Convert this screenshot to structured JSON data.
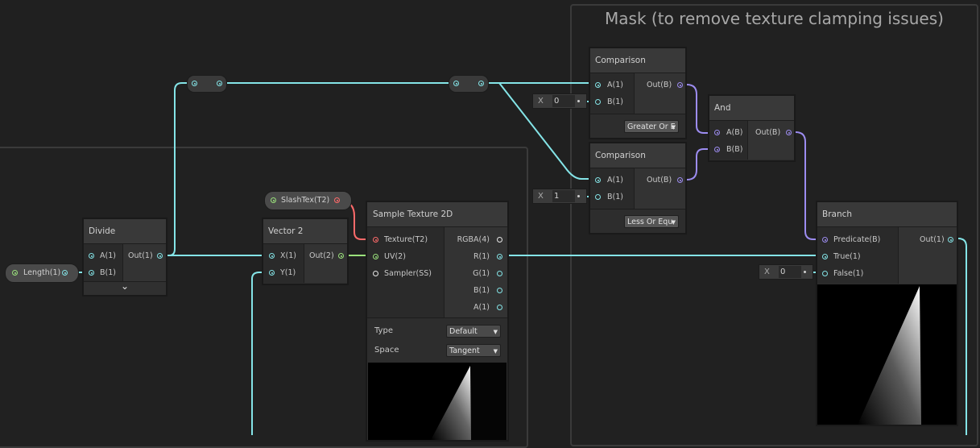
{
  "group": {
    "title": "Mask (to remove texture clamping issues)"
  },
  "properties": {
    "length": "Length(1)",
    "slashtex": "SlashTex(T2)"
  },
  "nodes": {
    "divide": {
      "title": "Divide",
      "in_a": "A(1)",
      "in_b": "B(1)",
      "out": "Out(1)",
      "collapse": "⌄"
    },
    "vector2": {
      "title": "Vector 2",
      "in_x": "X(1)",
      "in_y": "Y(1)",
      "out": "Out(2)"
    },
    "sample": {
      "title": "Sample Texture 2D",
      "in_texture": "Texture(T2)",
      "in_uv": "UV(2)",
      "in_sampler": "Sampler(SS)",
      "out_rgba": "RGBA(4)",
      "out_r": "R(1)",
      "out_g": "G(1)",
      "out_b": "B(1)",
      "out_a": "A(1)",
      "type_label": "Type",
      "type_value": "Default",
      "space_label": "Space",
      "space_value": "Tangent"
    },
    "comparison1": {
      "title": "Comparison",
      "in_a": "A(1)",
      "in_b": "B(1)",
      "out": "Out(B)",
      "mode": "Greater Or E"
    },
    "comparison2": {
      "title": "Comparison",
      "in_a": "A(1)",
      "in_b": "B(1)",
      "out": "Out(B)",
      "mode": "Less Or Equ"
    },
    "and": {
      "title": "And",
      "in_a": "A(B)",
      "in_b": "B(B)",
      "out": "Out(B)"
    },
    "branch": {
      "title": "Branch",
      "in_pred": "Predicate(B)",
      "in_true": "True(1)",
      "in_false": "False(1)",
      "out": "Out(1)"
    }
  },
  "fields": {
    "cmp1_b": {
      "label": "X",
      "value": "0"
    },
    "cmp2_b": {
      "label": "X",
      "value": "1"
    },
    "branch_false": {
      "label": "X",
      "value": "0"
    }
  },
  "colors": {
    "float_wire": "#84e4e7",
    "bool_wire": "#9c8cf0",
    "vector2_wire": "#9be27c",
    "texture_wire": "#ff6a6a"
  }
}
